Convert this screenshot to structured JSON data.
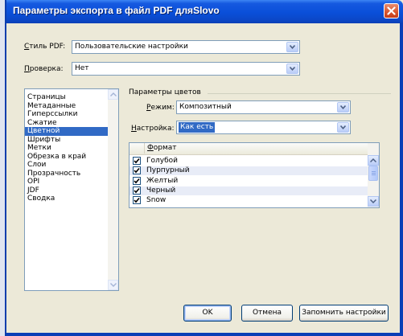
{
  "window": {
    "title": "Параметры экспорта в файл PDF дляSlovo"
  },
  "style_pdf": {
    "label": "Стиль PDF:",
    "label_accel": "С",
    "label_rest": "тиль PDF:",
    "value": "Пользовательские настройки"
  },
  "check": {
    "label_accel": "П",
    "label_rest": "роверка:",
    "value": "Нет"
  },
  "sidebar": {
    "items": [
      "Страницы",
      "Метаданные",
      "Гиперссылки",
      "Сжатие",
      "Цветной",
      "Шрифты",
      "Метки",
      "Обрезка в край",
      "Слои",
      "Прозрачность",
      "OPI",
      "JDF",
      "Сводка"
    ],
    "selected_index": 4
  },
  "color_params": {
    "title": "Параметры цветов",
    "mode_label_accel": "Р",
    "mode_label_rest": "ежим:",
    "mode_value": "Композитный",
    "setting_label_accel": "Н",
    "setting_label_rest": "астройка:",
    "setting_value": "Как есть"
  },
  "format_table": {
    "header_accel": "Ф",
    "header_rest": "ормат",
    "rows": [
      {
        "label": "Голубой",
        "checked": true
      },
      {
        "label": "Пурпурный",
        "checked": true
      },
      {
        "label": "Желтый",
        "checked": true
      },
      {
        "label": "Черный",
        "checked": true
      },
      {
        "label": "Snow",
        "checked": true
      }
    ]
  },
  "buttons": {
    "ok": "OK",
    "cancel": "Отмена",
    "save": "Запомнить настройки"
  },
  "colors": {
    "titlebar": "#0b4fd9",
    "selection": "#316ac5",
    "dialog_bg": "#ece9d8",
    "close_button": "#d8542c"
  }
}
